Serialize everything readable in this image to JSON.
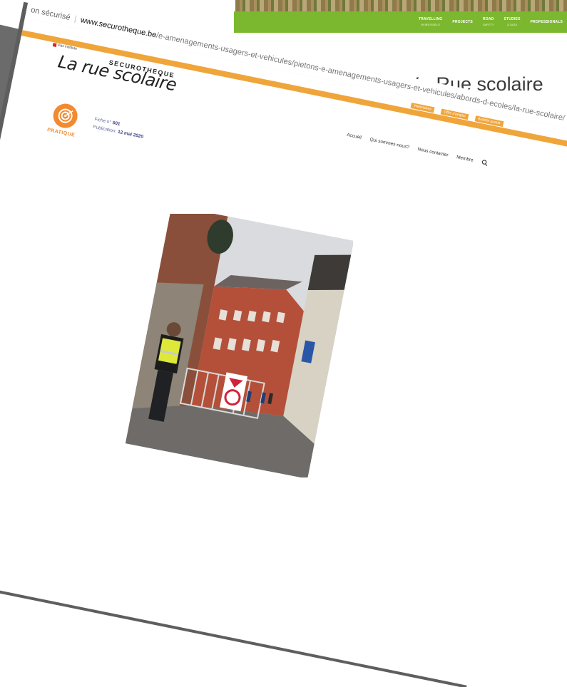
{
  "background_page": {
    "nav": [
      {
        "main": "TRAVELLING",
        "sub": "IN BRUSSELS"
      },
      {
        "main": "PROJECTS",
        "sub": ""
      },
      {
        "main": "ROAD",
        "sub": "SAFETY"
      },
      {
        "main": "STUDIES",
        "sub": "& DATA"
      },
      {
        "main": "PROFESSIONALS",
        "sub": ""
      }
    ],
    "heading": "DIY - Rue scolaire",
    "accent_color": "#7cb82f"
  },
  "browser": {
    "address": {
      "security": "on sécurisé",
      "domain": "www.securotheque.be",
      "path": "/e-amenagements-usagers-et-vehicules/pietons-e-amenagements-usagers-et-vehicules/abords-d-ecoles/la-rue-scolaire/"
    },
    "utility_links": [
      "Webinaires",
      "Offre d'emploi",
      "Bulletin gratuit"
    ]
  },
  "site": {
    "logo_text": "Vias institute",
    "brand": "SECUROTHEQUE",
    "nav": [
      "Accueil",
      "Qui sommes-nous?",
      "Nous contacter",
      "Membre"
    ],
    "accent_color": "#f0a53a",
    "page_title": "La rue scolaire",
    "category_badge": "PRATIQUE",
    "fiche_label": "Fiche n°",
    "fiche_number": "501",
    "publication_label": "Publication:",
    "publication_date": "12 mai 2020"
  },
  "icons": {
    "search": "search-icon",
    "target": "target-icon"
  }
}
